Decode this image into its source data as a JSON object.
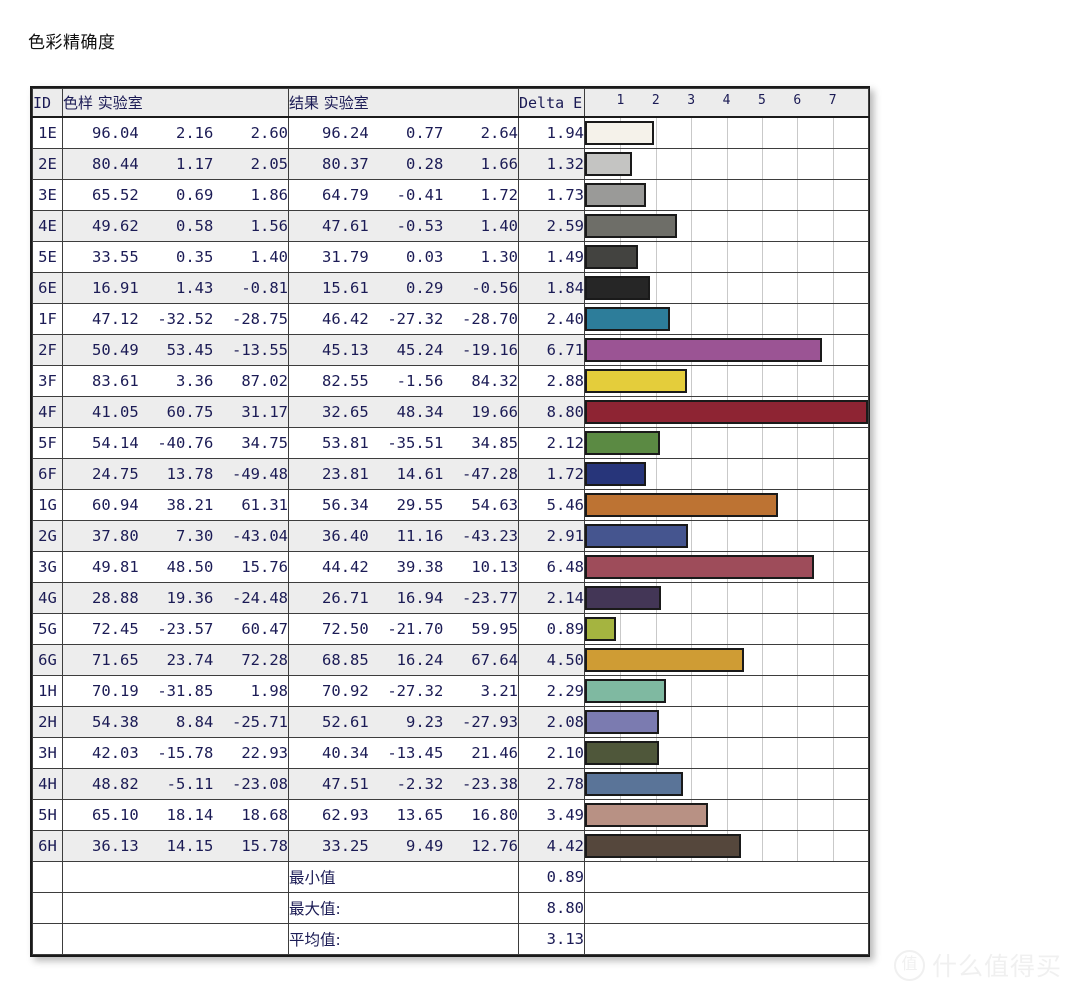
{
  "page": {
    "title": "色彩精确度"
  },
  "watermark": {
    "badge": "值",
    "text": "什么值得买"
  },
  "table": {
    "headers": {
      "id": "ID",
      "sample_lab": "色样 实验室",
      "result_lab": "结果 实验室",
      "delta_e": "Delta E"
    },
    "summary": [
      {
        "label": "最小值",
        "value": "0.89"
      },
      {
        "label": "最大值:",
        "value": "8.80"
      },
      {
        "label": "平均值:",
        "value": "3.13"
      }
    ]
  },
  "chart_data": {
    "type": "bar",
    "title": "色彩精确度",
    "xlabel": "Delta E",
    "ylabel": "",
    "orientation": "horizontal",
    "grid": true,
    "legend": false,
    "xlim": [
      0,
      8.0
    ],
    "xticks": [
      1,
      2,
      3,
      4,
      5,
      6,
      7
    ],
    "categories": [
      "1E",
      "2E",
      "3E",
      "4E",
      "5E",
      "6E",
      "1F",
      "2F",
      "3F",
      "4F",
      "5F",
      "6F",
      "1G",
      "2G",
      "3G",
      "4G",
      "5G",
      "6G",
      "1H",
      "2H",
      "3H",
      "4H",
      "5H",
      "6H"
    ],
    "values": [
      1.94,
      1.32,
      1.73,
      2.59,
      1.49,
      1.84,
      2.4,
      6.71,
      2.88,
      8.8,
      2.12,
      1.72,
      5.46,
      2.91,
      6.48,
      2.14,
      0.89,
      4.5,
      2.29,
      2.08,
      2.1,
      2.78,
      3.49,
      4.42
    ],
    "bar_colors": [
      "#f5f2ea",
      "#c4c4c2",
      "#9a9a98",
      "#6e6e68",
      "#434340",
      "#262626",
      "#2d7d9a",
      "#9b5494",
      "#e4cd3b",
      "#8e2433",
      "#5b8a43",
      "#27357a",
      "#bd7333",
      "#45558f",
      "#9e4c5a",
      "#433656",
      "#a5b440",
      "#cf9c34",
      "#7fb9a1",
      "#7b7bb0",
      "#4f573a",
      "#5a7498",
      "#b89184",
      "#55473c"
    ],
    "min": 0.89,
    "max": 8.8,
    "average": 3.13
  },
  "rows": [
    {
      "id": "1E",
      "sample": "96.04    2.16    2.60",
      "result": "96.24    0.77    2.64",
      "delta_e": "1.94",
      "value": 1.94,
      "color": "#f5f2ea"
    },
    {
      "id": "2E",
      "sample": "80.44    1.17    2.05",
      "result": "80.37    0.28    1.66",
      "delta_e": "1.32",
      "value": 1.32,
      "color": "#c4c4c2"
    },
    {
      "id": "3E",
      "sample": "65.52    0.69    1.86",
      "result": "64.79   -0.41    1.72",
      "delta_e": "1.73",
      "value": 1.73,
      "color": "#9a9a98"
    },
    {
      "id": "4E",
      "sample": "49.62    0.58    1.56",
      "result": "47.61   -0.53    1.40",
      "delta_e": "2.59",
      "value": 2.59,
      "color": "#6e6e68"
    },
    {
      "id": "5E",
      "sample": "33.55    0.35    1.40",
      "result": "31.79    0.03    1.30",
      "delta_e": "1.49",
      "value": 1.49,
      "color": "#434340"
    },
    {
      "id": "6E",
      "sample": "16.91    1.43   -0.81",
      "result": "15.61    0.29   -0.56",
      "delta_e": "1.84",
      "value": 1.84,
      "color": "#262626"
    },
    {
      "id": "1F",
      "sample": "47.12  -32.52  -28.75",
      "result": "46.42  -27.32  -28.70",
      "delta_e": "2.40",
      "value": 2.4,
      "color": "#2d7d9a"
    },
    {
      "id": "2F",
      "sample": "50.49   53.45  -13.55",
      "result": "45.13   45.24  -19.16",
      "delta_e": "6.71",
      "value": 6.71,
      "color": "#9b5494"
    },
    {
      "id": "3F",
      "sample": "83.61    3.36   87.02",
      "result": "82.55   -1.56   84.32",
      "delta_e": "2.88",
      "value": 2.88,
      "color": "#e4cd3b"
    },
    {
      "id": "4F",
      "sample": "41.05   60.75   31.17",
      "result": "32.65   48.34   19.66",
      "delta_e": "8.80",
      "value": 8.8,
      "color": "#8e2433"
    },
    {
      "id": "5F",
      "sample": "54.14  -40.76   34.75",
      "result": "53.81  -35.51   34.85",
      "delta_e": "2.12",
      "value": 2.12,
      "color": "#5b8a43"
    },
    {
      "id": "6F",
      "sample": "24.75   13.78  -49.48",
      "result": "23.81   14.61  -47.28",
      "delta_e": "1.72",
      "value": 1.72,
      "color": "#27357a"
    },
    {
      "id": "1G",
      "sample": "60.94   38.21   61.31",
      "result": "56.34   29.55   54.63",
      "delta_e": "5.46",
      "value": 5.46,
      "color": "#bd7333"
    },
    {
      "id": "2G",
      "sample": "37.80    7.30  -43.04",
      "result": "36.40   11.16  -43.23",
      "delta_e": "2.91",
      "value": 2.91,
      "color": "#45558f"
    },
    {
      "id": "3G",
      "sample": "49.81   48.50   15.76",
      "result": "44.42   39.38   10.13",
      "delta_e": "6.48",
      "value": 6.48,
      "color": "#9e4c5a"
    },
    {
      "id": "4G",
      "sample": "28.88   19.36  -24.48",
      "result": "26.71   16.94  -23.77",
      "delta_e": "2.14",
      "value": 2.14,
      "color": "#433656"
    },
    {
      "id": "5G",
      "sample": "72.45  -23.57   60.47",
      "result": "72.50  -21.70   59.95",
      "delta_e": "0.89",
      "value": 0.89,
      "color": "#a5b440"
    },
    {
      "id": "6G",
      "sample": "71.65   23.74   72.28",
      "result": "68.85   16.24   67.64",
      "delta_e": "4.50",
      "value": 4.5,
      "color": "#cf9c34"
    },
    {
      "id": "1H",
      "sample": "70.19  -31.85    1.98",
      "result": "70.92  -27.32    3.21",
      "delta_e": "2.29",
      "value": 2.29,
      "color": "#7fb9a1"
    },
    {
      "id": "2H",
      "sample": "54.38    8.84  -25.71",
      "result": "52.61    9.23  -27.93",
      "delta_e": "2.08",
      "value": 2.08,
      "color": "#7b7bb0"
    },
    {
      "id": "3H",
      "sample": "42.03  -15.78   22.93",
      "result": "40.34  -13.45   21.46",
      "delta_e": "2.10",
      "value": 2.1,
      "color": "#4f573a"
    },
    {
      "id": "4H",
      "sample": "48.82   -5.11  -23.08",
      "result": "47.51   -2.32  -23.38",
      "delta_e": "2.78",
      "value": 2.78,
      "color": "#5a7498"
    },
    {
      "id": "5H",
      "sample": "65.10   18.14   18.68",
      "result": "62.93   13.65   16.80",
      "delta_e": "3.49",
      "value": 3.49,
      "color": "#b89184"
    },
    {
      "id": "6H",
      "sample": "36.13   14.15   15.78",
      "result": "33.25    9.49   12.76",
      "delta_e": "4.42",
      "value": 4.42,
      "color": "#55473c"
    }
  ]
}
